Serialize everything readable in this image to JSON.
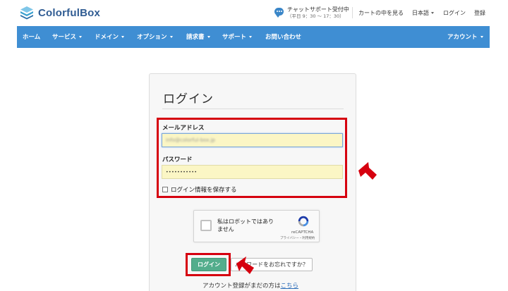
{
  "brand": {
    "name": "ColorfulBox"
  },
  "header": {
    "chat_title": "チャットサポート受付中",
    "chat_hours": "（平日 9：30 〜 17：30）",
    "links": [
      "カートの中を見る",
      "日本語",
      "ログイン",
      "登録"
    ]
  },
  "nav": {
    "items": [
      "ホーム",
      "サービス",
      "ドメイン",
      "オプション",
      "請求書",
      "サポート",
      "お問い合わせ"
    ],
    "account": "アカウント"
  },
  "login": {
    "title": "ログイン",
    "email_label": "メールアドレス",
    "email_value": "info@colorful-box.jp",
    "password_label": "パスワード",
    "password_value": "•••••••••••",
    "remember_label": "ログイン情報を保存する",
    "remember_checked": false,
    "submit_label": "ログイン",
    "forgot_label": "パスワードをお忘れですか？",
    "signup_prefix": "アカウント登録がまだの方は",
    "signup_link": "こちら"
  },
  "captcha": {
    "label": "私はロボットではありません",
    "brand": "reCAPTCHA",
    "links": "プライバシー・利用規約"
  },
  "colors": {
    "nav": "#3f8ed3",
    "submit": "#53ad8c",
    "highlight": "#d6000f",
    "autofill": "#fbf6c5"
  }
}
